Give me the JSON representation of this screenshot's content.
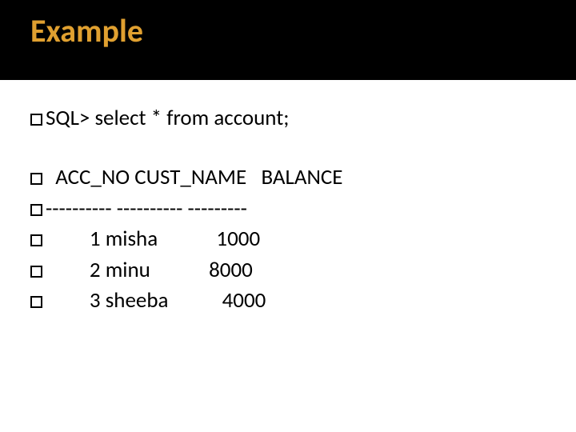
{
  "title": "Example",
  "lines": {
    "l0": "SQL> select * from account;",
    "l1": "  ACC_NO CUST_NAME   BALANCE",
    "l2": "---------- ---------- ---------",
    "l3": "         1 misha            1000",
    "l4": "         2 minu            8000",
    "l5": "         3 sheeba           4000"
  },
  "chart_data": {
    "type": "table",
    "title": "Example",
    "query": "SQL> select * from account;",
    "columns": [
      "ACC_NO",
      "CUST_NAME",
      "BALANCE"
    ],
    "rows": [
      {
        "ACC_NO": 1,
        "CUST_NAME": "misha",
        "BALANCE": 1000
      },
      {
        "ACC_NO": 2,
        "CUST_NAME": "minu",
        "BALANCE": 8000
      },
      {
        "ACC_NO": 3,
        "CUST_NAME": "sheeba",
        "BALANCE": 4000
      }
    ]
  }
}
